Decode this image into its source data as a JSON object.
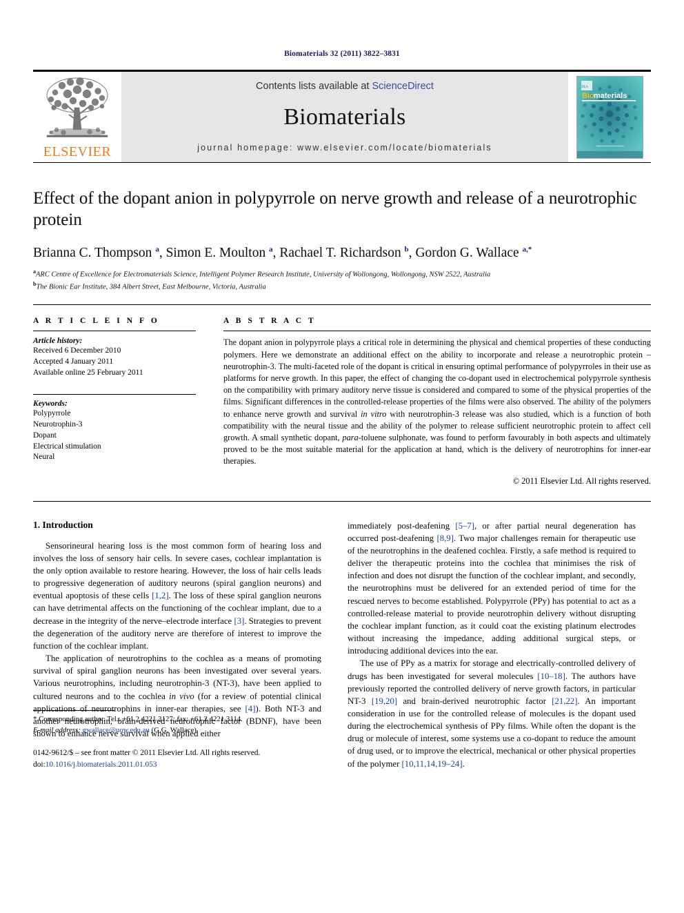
{
  "running_head": "Biomaterials 32 (2011) 3822–3831",
  "masthead": {
    "publisher_name": "ELSEVIER",
    "contents_prefix": "Contents lists available at ",
    "contents_link": "ScienceDirect",
    "journal_name": "Biomaterials",
    "homepage": "journal homepage: www.elsevier.com/locate/biomaterials",
    "cover_title": "Biomaterials",
    "colors": {
      "elsevier_orange": "#E87D1E",
      "link_blue": "#3a4ba8",
      "cover_teal": "#4fb3b8",
      "masthead_grey": "#e6e6e6"
    }
  },
  "article": {
    "title": "Effect of the dopant anion in polypyrrole on nerve growth and release of a neurotrophic protein",
    "authors_html": "Brianna C. Thompson <sup>a</sup>, Simon E. Moulton <sup>a</sup>, Rachael T. Richardson <sup>b</sup>, Gordon G. Wallace <sup>a,</sup><sup>*</sup>",
    "affiliations": [
      {
        "marker": "a",
        "text": "ARC Centre of Excellence for Electromaterials Science, Intelligent Polymer Research Institute, University of Wollongong, Wollongong, NSW 2522, Australia"
      },
      {
        "marker": "b",
        "text": "The Bionic Ear Institute, 384 Albert Street, East Melbourne, Victoria, Australia"
      }
    ]
  },
  "article_info": {
    "heading": "A R T I C L E   I N F O",
    "history_label": "Article history:",
    "history": [
      "Received 6 December 2010",
      "Accepted 4 January 2011",
      "Available online 25 February 2011"
    ],
    "keywords_label": "Keywords:",
    "keywords": [
      "Polypyrrole",
      "Neurotrophin-3",
      "Dopant",
      "Electrical stimulation",
      "Neural"
    ]
  },
  "abstract": {
    "heading": "A B S T R A C T",
    "text": "The dopant anion in polypyrrole plays a critical role in determining the physical and chemical properties of these conducting polymers. Here we demonstrate an additional effect on the ability to incorporate and release a neurotrophic protein – neurotrophin-3. The multi-faceted role of the dopant is critical in ensuring optimal performance of polypyrroles in their use as platforms for nerve growth. In this paper, the effect of changing the co-dopant used in electrochemical polypyrrole synthesis on the compatibility with primary auditory nerve tissue is considered and compared to some of the physical properties of the films. Significant differences in the controlled-release properties of the films were also observed. The ability of the polymers to enhance nerve growth and survival in vitro with neurotrophin-3 release was also studied, which is a function of both compatibility with the neural tissue and the ability of the polymer to release sufficient neurotrophic protein to affect cell growth. A small synthetic dopant, para-toluene sulphonate, was found to perform favourably in both aspects and ultimately proved to be the most suitable material for the application at hand, which is the delivery of neurotrophins for inner-ear therapies.",
    "italic_fragments": [
      "in vitro",
      "para-"
    ],
    "copyright": "© 2011 Elsevier Ltd. All rights reserved."
  },
  "introduction": {
    "heading": "1. Introduction",
    "left_paragraphs": [
      "Sensorineural hearing loss is the most common form of hearing loss and involves the loss of sensory hair cells. In severe cases, cochlear implantation is the only option available to restore hearing. However, the loss of hair cells leads to progressive degeneration of auditory neurons (spiral ganglion neurons) and eventual apoptosis of these cells [1,2]. The loss of these spiral ganglion neurons can have detrimental affects on the functioning of the cochlear implant, due to a decrease in the integrity of the nerve–electrode interface [3]. Strategies to prevent the degeneration of the auditory nerve are therefore of interest to improve the function of the cochlear implant.",
      "The application of neurotrophins to the cochlea as a means of promoting survival of spiral ganglion neurons has been investigated over several years. Various neurotrophins, including neurotrophin-3 (NT-3), have been applied to cultured neurons and to the cochlea in vivo (for a review of potential clinical applications of neurotrophins in inner-ear therapies, see [4]). Both NT-3 and another neurotrophin, brain-derived neurotrophic factor (BDNF), have been shown to enhance nerve survival when applied either"
    ],
    "right_paragraphs": [
      "immediately post-deafening [5–7], or after partial neural degeneration has occurred post-deafening [8,9]. Two major challenges remain for therapeutic use of the neurotrophins in the deafened cochlea. Firstly, a safe method is required to deliver the therapeutic proteins into the cochlea that minimises the risk of infection and does not disrupt the function of the cochlear implant, and secondly, the neurotrophins must be delivered for an extended period of time for the rescued nerves to become established. Polypyrrole (PPy) has potential to act as a controlled-release material to provide neurotrophin delivery without disrupting the cochlear implant function, as it could coat the existing platinum electrodes without increasing the impedance, adding additional surgical steps, or introducing additional devices into the ear.",
      "The use of PPy as a matrix for storage and electrically-controlled delivery of drugs has been investigated for several molecules [10–18]. The authors have previously reported the controlled delivery of nerve growth factors, in particular NT-3 [19,20] and brain-derived neurotrophic factor [21,22]. An important consideration in use for the controlled release of molecules is the dopant used during the electrochemical synthesis of PPy films. While often the dopant is the drug or molecule of interest, some systems use a co-dopant to reduce the amount of drug used, or to improve the electrical, mechanical or other physical properties of the polymer [10,11,14,19–24]."
    ]
  },
  "footnote": {
    "corresponding": "* Corresponding author. Tel.: +61 2 4221 3127; fax: +61 2 4221 3114.",
    "email_label": "E-mail address:",
    "email": "gwallace@uow.edu.au",
    "email_suffix": "(G.G. Wallace).",
    "front_matter": "0142-9612/$ – see front matter © 2011 Elsevier Ltd. All rights reserved.",
    "doi_label": "doi:",
    "doi": "10.1016/j.biomaterials.2011.01.053"
  }
}
